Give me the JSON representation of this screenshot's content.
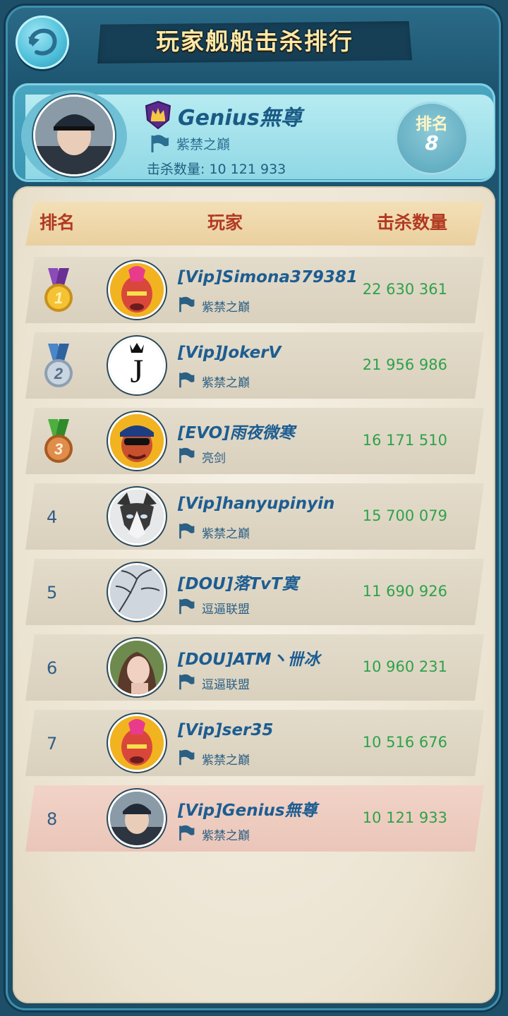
{
  "header": {
    "title": "玩家舰船击杀排行"
  },
  "my_entry": {
    "name": "Genius無尊",
    "guild": "紫禁之巔",
    "kills_label": "击杀数量:",
    "kills_value": "10 121 933",
    "rank_label": "排名",
    "rank_value": "8"
  },
  "columns": {
    "rank": "排名",
    "player": "玩家",
    "kills": "击杀数量"
  },
  "rows": [
    {
      "rank": "1",
      "name": "[Vip]Simona379381",
      "guild": "紫禁之巔",
      "kills": "22 630 361",
      "medal": "gold",
      "avatar": "red-warrior"
    },
    {
      "rank": "2",
      "name": "[Vip]JokerV",
      "guild": "紫禁之巔",
      "kills": "21 956 986",
      "medal": "silver",
      "avatar": "letter-j"
    },
    {
      "rank": "3",
      "name": "[EVO]雨夜微寒",
      "guild": "亮剑",
      "kills": "16 171 510",
      "medal": "bronze",
      "avatar": "pilot"
    },
    {
      "rank": "4",
      "name": "[Vip]hanyupinyin",
      "guild": "紫禁之巔",
      "kills": "15 700 079",
      "avatar": "husky"
    },
    {
      "rank": "5",
      "name": "[DOU]落TvT寞",
      "guild": "逗逼联盟",
      "kills": "11 690 926",
      "avatar": "tree"
    },
    {
      "rank": "6",
      "name": "[DOU]ATM丶卌冰",
      "guild": "逗逼联盟",
      "kills": "10 960 231",
      "avatar": "girl"
    },
    {
      "rank": "7",
      "name": "[Vip]ser35",
      "guild": "紫禁之巔",
      "kills": "10 516 676",
      "avatar": "red-warrior"
    },
    {
      "rank": "8",
      "name": "[Vip]Genius無尊",
      "guild": "紫禁之巔",
      "kills": "10 121 933",
      "avatar": "officer",
      "is_self": true
    }
  ],
  "colors": {
    "accent_blue": "#1d5d91",
    "kills_green": "#2ea24a",
    "header_red": "#b13a22",
    "title_gold": "#ffe9a8",
    "self_row": "#f1d3c7"
  }
}
